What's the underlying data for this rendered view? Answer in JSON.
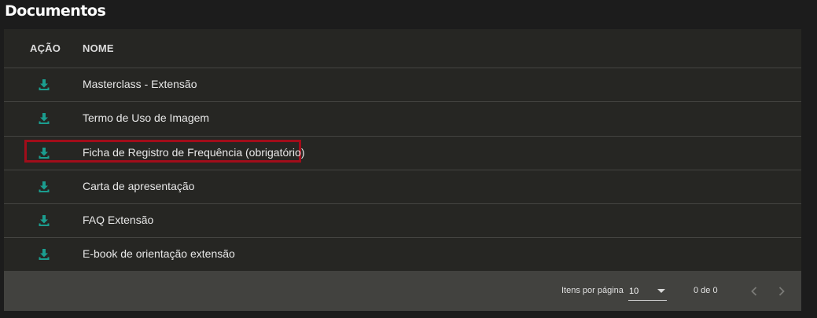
{
  "page": {
    "title": "Documentos"
  },
  "table": {
    "headers": {
      "action": "AÇÃO",
      "name": "NOME"
    },
    "rows": [
      {
        "name": "Masterclass - Extensão",
        "icon": "download-icon",
        "highlighted": false
      },
      {
        "name": "Termo de Uso de Imagem",
        "icon": "download-icon",
        "highlighted": false
      },
      {
        "name": "Ficha de Registro de Frequência (obrigatório)",
        "icon": "download-icon",
        "highlighted": true
      },
      {
        "name": "Carta de apresentação",
        "icon": "download-icon",
        "highlighted": false
      },
      {
        "name": "FAQ Extensão",
        "icon": "download-icon",
        "highlighted": false
      },
      {
        "name": "E-book de orientação extensão",
        "icon": "download-icon",
        "highlighted": false
      }
    ]
  },
  "paginator": {
    "items_per_page_label": "Itens por página",
    "items_per_page_value": "10",
    "range_label": "0 de 0",
    "prev_icon": "chevron-left-icon",
    "next_icon": "chevron-right-icon"
  },
  "colors": {
    "background": "#1c1c1c",
    "card": "#262623",
    "footer": "#42423f",
    "icon_teal": "#1b9d8f",
    "highlight_border": "#a10d1a"
  }
}
